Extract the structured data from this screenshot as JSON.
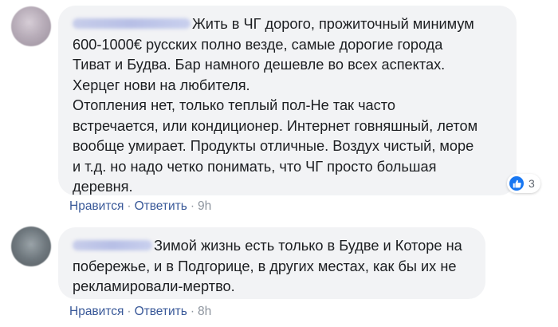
{
  "comments": [
    {
      "author": "Наталья Малько",
      "lines": [
        "Жить в ЧГ дорого, прожиточный минимум",
        "600-1000€ русских полно везде, самые дорогие города",
        "Тиват и Будва. Бар намного дешевле во всех аспектах.",
        "Херцег нови на любителя.",
        "Отопления нет, только теплый пол-Не так часто",
        "встречается, или кондиционер. Интернет говняшный, летом",
        "вообще умирает. Продукты отличные. Воздух чистый, море",
        "и т.д. но надо четко понимать, что ЧГ просто большая",
        "деревня."
      ],
      "reactions_count": "3",
      "like_label": "Нравится",
      "reply_label": "Ответить",
      "time": "9h"
    },
    {
      "author": "Иван Тайков",
      "lines": [
        "Зимой жизнь есть только в Будве и Которе на",
        "побережье, и в Подгорице, в других местах, как бы их не",
        "рекламировали-мертво."
      ],
      "like_label": "Нравится",
      "reply_label": "Ответить",
      "time": "8h"
    }
  ],
  "colors": {
    "bubble": "#f2f3f5",
    "link": "#385898",
    "like_blue": "#1877f2"
  },
  "icons": [
    "avatar",
    "like-thumbs-up-icon"
  ]
}
